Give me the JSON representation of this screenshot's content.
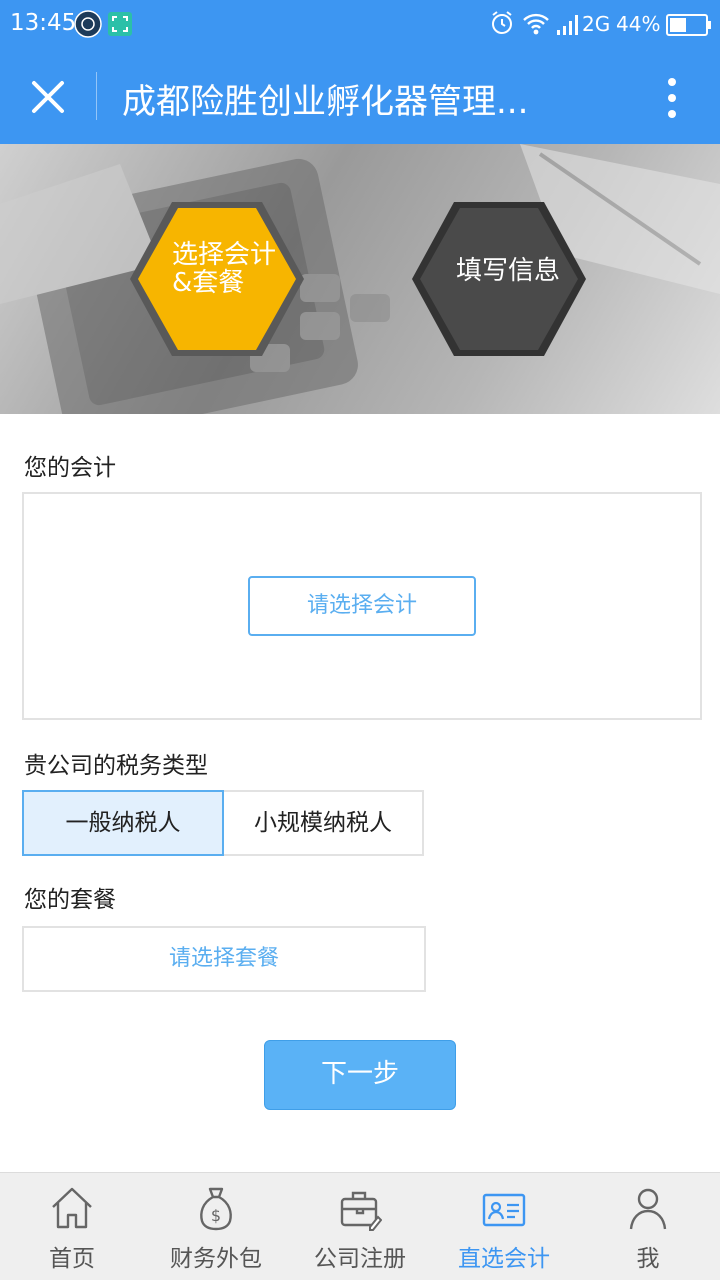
{
  "status_bar": {
    "time": "13:45",
    "network": "2G",
    "battery": "44%"
  },
  "nav": {
    "title": "成都险胜创业孵化器管理..."
  },
  "banner": {
    "step1": "选择会计\n&套餐",
    "arrows": ">>>>>>",
    "step2": "填写信息"
  },
  "form": {
    "accountant_label": "您的会计",
    "accountant_button": "请选择会计",
    "tax_type_label": "贵公司的税务类型",
    "tax_options": [
      "一般纳税人",
      "小规模纳税人"
    ],
    "selected_tax_option": "一般纳税人",
    "package_label": "您的套餐",
    "package_button": "请选择套餐",
    "next_button": "下一步"
  },
  "tabs": [
    {
      "label": "首页",
      "icon": "home-icon"
    },
    {
      "label": "财务外包",
      "icon": "money-bag-icon"
    },
    {
      "label": "公司注册",
      "icon": "briefcase-icon"
    },
    {
      "label": "直选会计",
      "icon": "id-card-icon"
    },
    {
      "label": "我",
      "icon": "person-icon"
    }
  ],
  "active_tab": "直选会计",
  "colors": {
    "primary": "#3d96f2",
    "accent_blue": "#5aaef0",
    "step_active": "#f7b500",
    "step_inactive": "#4a4a4a",
    "next_button": "#5ab2f6"
  }
}
